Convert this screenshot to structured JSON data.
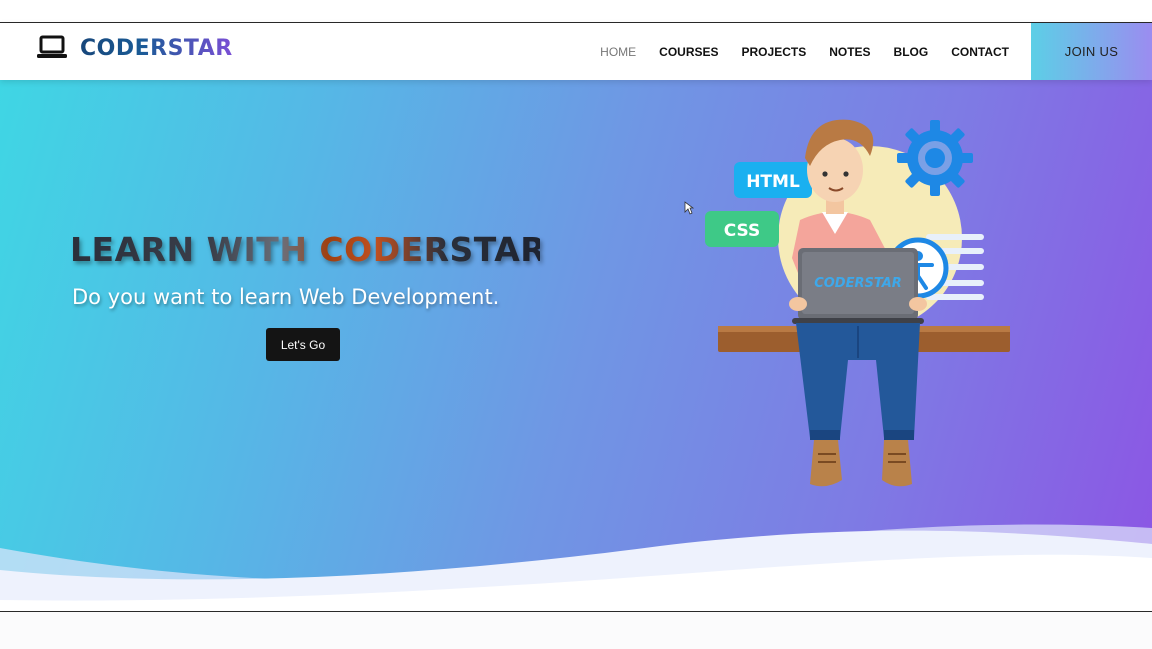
{
  "brand": {
    "name": "CODERSTAR",
    "logo_icon": "laptop-icon"
  },
  "nav": {
    "items": [
      {
        "label": "HOME",
        "active": true
      },
      {
        "label": "COURSES",
        "active": false
      },
      {
        "label": "PROJECTS",
        "active": false
      },
      {
        "label": "NOTES",
        "active": false
      },
      {
        "label": "BLOG",
        "active": false
      },
      {
        "label": "CONTACT",
        "active": false
      }
    ],
    "join_label": "JOIN US"
  },
  "hero": {
    "title": "LEARN WITH CODERSTAR",
    "subtitle": "Do you want to learn Web Development.",
    "cta_label": "Let's Go"
  },
  "illustration": {
    "tags": [
      "HTML",
      "CSS"
    ],
    "laptop_text": "CODERSTAR",
    "icons": [
      "gear-icon",
      "accessibility-icon"
    ]
  },
  "colors": {
    "gradient_start": "#3fd6e4",
    "gradient_end": "#8c55e4",
    "join_button_start": "#5ccfe6",
    "join_button_end": "#9b8cf0",
    "html_tag": "#1ab0f0",
    "css_tag": "#3ec987",
    "cta_background": "#141414"
  }
}
